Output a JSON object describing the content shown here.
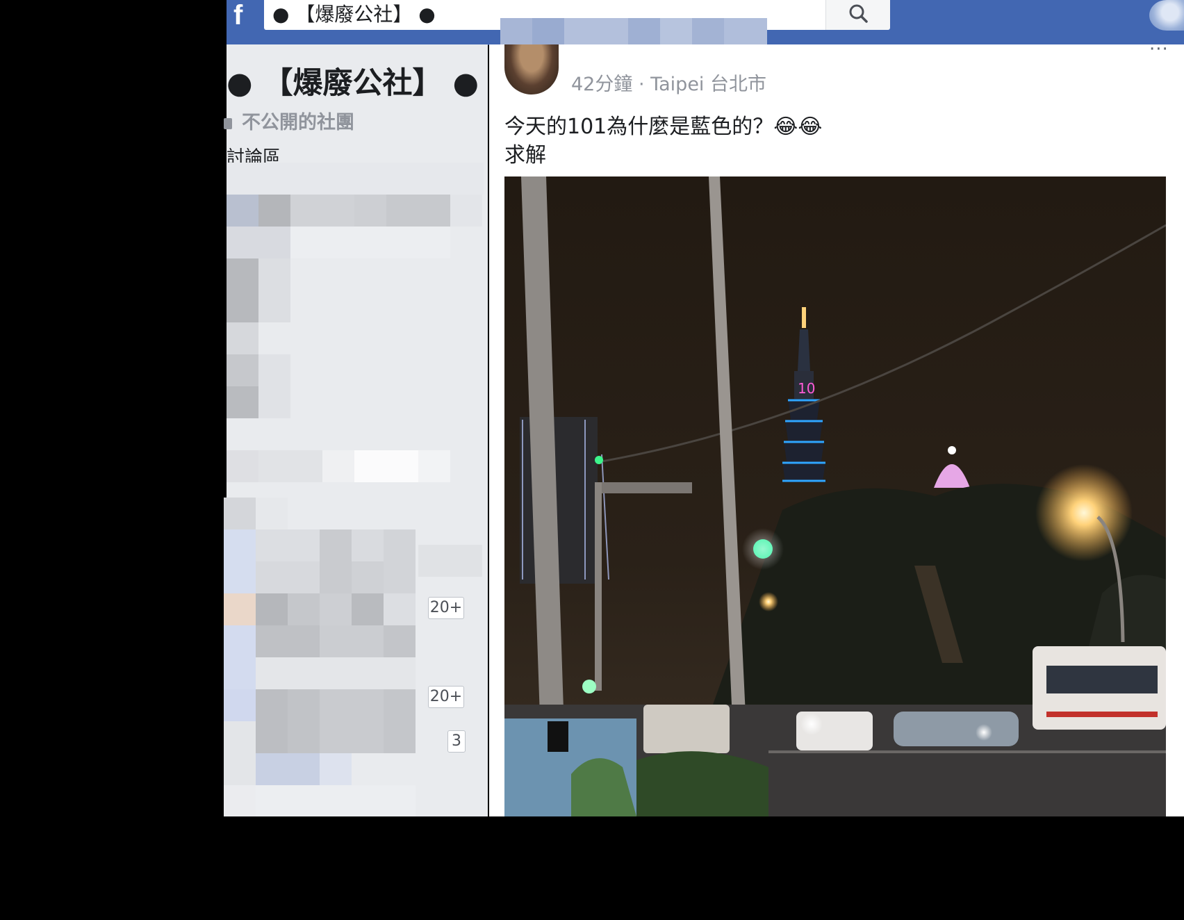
{
  "topbar": {
    "logo": "f",
    "search_value": "● 【爆廢公社】 ●",
    "search_icon": "search-icon"
  },
  "sidebar": {
    "group_name": "● 【爆廢公社】 ●",
    "privacy": "不公開的社團",
    "section_label": "討論區",
    "badges": [
      "20+",
      "20+",
      "3"
    ]
  },
  "post": {
    "meta": "42分鐘 · Taipei 台北市",
    "text_line1": "今天的101為什麼是藍色的？😂😂",
    "text_line2": "求解",
    "more_icon": "···",
    "photo_alt": "Night street view of Taipei 101"
  },
  "colors": {
    "facebook_blue": "#4267b2",
    "sidebar_bg": "#e9ebee",
    "text_primary": "#1c1e21",
    "text_secondary": "#90949c"
  }
}
